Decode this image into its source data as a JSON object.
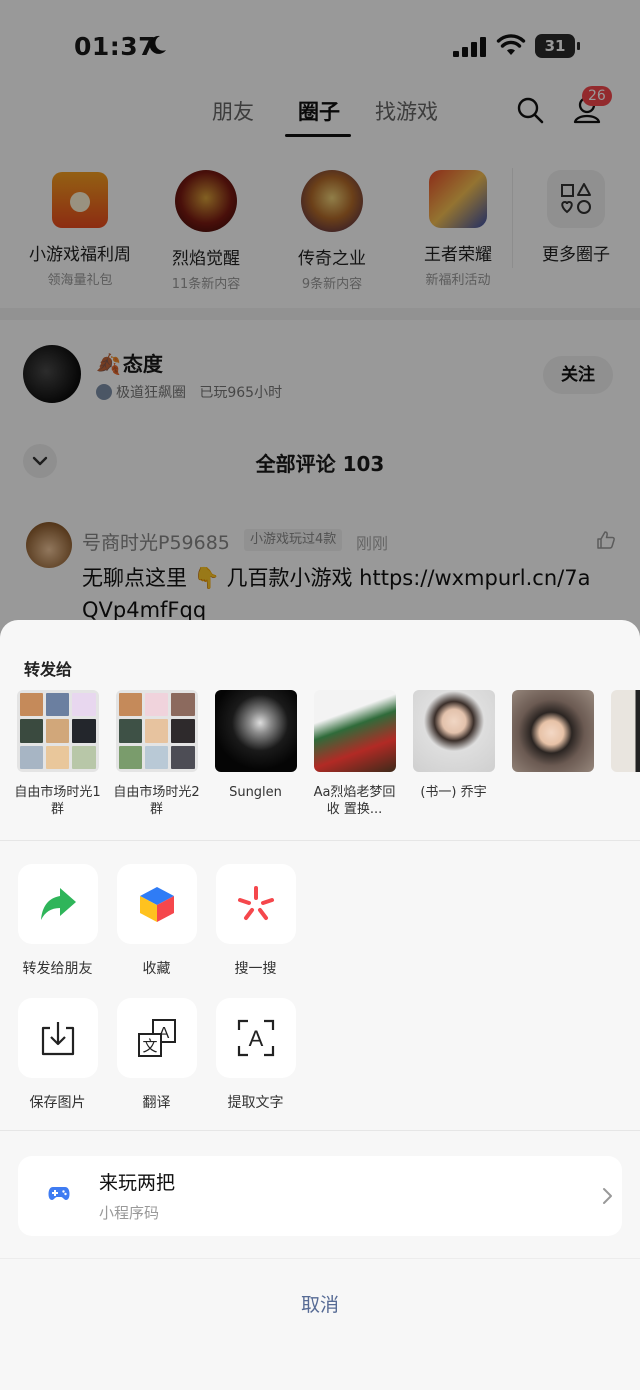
{
  "status_bar": {
    "time": "01:37",
    "battery": "31"
  },
  "nav": {
    "tabs": [
      "朋友",
      "圈子",
      "找游戏"
    ],
    "active_tab": "圈子",
    "notification_count": "26"
  },
  "circles": [
    {
      "name": "小游戏福利周",
      "sub": "领海量礼包",
      "icon": "gift-icon"
    },
    {
      "name": "烈焰觉醒",
      "sub": "11条新内容",
      "icon": "game-icon"
    },
    {
      "name": "传奇之业",
      "sub": "9条新内容",
      "icon": "game-icon"
    },
    {
      "name": "王者荣耀",
      "sub": "新福利活动",
      "icon": "game-icon"
    },
    {
      "name": "更多圈子",
      "sub": "",
      "icon": "shapes-icon"
    }
  ],
  "post": {
    "author": "态度",
    "circle": "极道狂飙圈",
    "play_time": "已玩965小时",
    "follow_label": "关注"
  },
  "comments": {
    "title": "全部评论 103",
    "first": {
      "name": "号商时光P59685",
      "tag": "小游戏玩过4款",
      "time": "刚刚",
      "text": "无聊点这里 👇 几百款小游戏 https://wxmpurl.cn/7aQVp4mfFqq"
    }
  },
  "share_sheet": {
    "title": "转发给",
    "contacts": [
      {
        "label": "自由市场时光1群",
        "kind": "group"
      },
      {
        "label": "自由市场时光2群",
        "kind": "group"
      },
      {
        "label": "Sunglen",
        "kind": "person"
      },
      {
        "label": "Aa烈焰老梦回收 置换...",
        "kind": "person"
      },
      {
        "label": "(书一) 乔宇",
        "kind": "person"
      },
      {
        "label": "",
        "kind": "person"
      },
      {
        "label": "",
        "kind": "person"
      }
    ],
    "actions_row1": [
      {
        "label": "转发给朋友",
        "icon": "forward-icon"
      },
      {
        "label": "收藏",
        "icon": "favorite-cube-icon"
      },
      {
        "label": "搜一搜",
        "icon": "search-spark-icon"
      }
    ],
    "actions_row2": [
      {
        "label": "保存图片",
        "icon": "download-icon"
      },
      {
        "label": "翻译",
        "icon": "translate-icon"
      },
      {
        "label": "提取文字",
        "icon": "text-scan-icon"
      }
    ],
    "mini_program": {
      "title": "来玩两把",
      "subtitle": "小程序码"
    },
    "cancel_label": "取消"
  },
  "colors": {
    "badge": "#f5474c",
    "cancel_text": "#576b95",
    "forward_green": "#2fb55a"
  }
}
